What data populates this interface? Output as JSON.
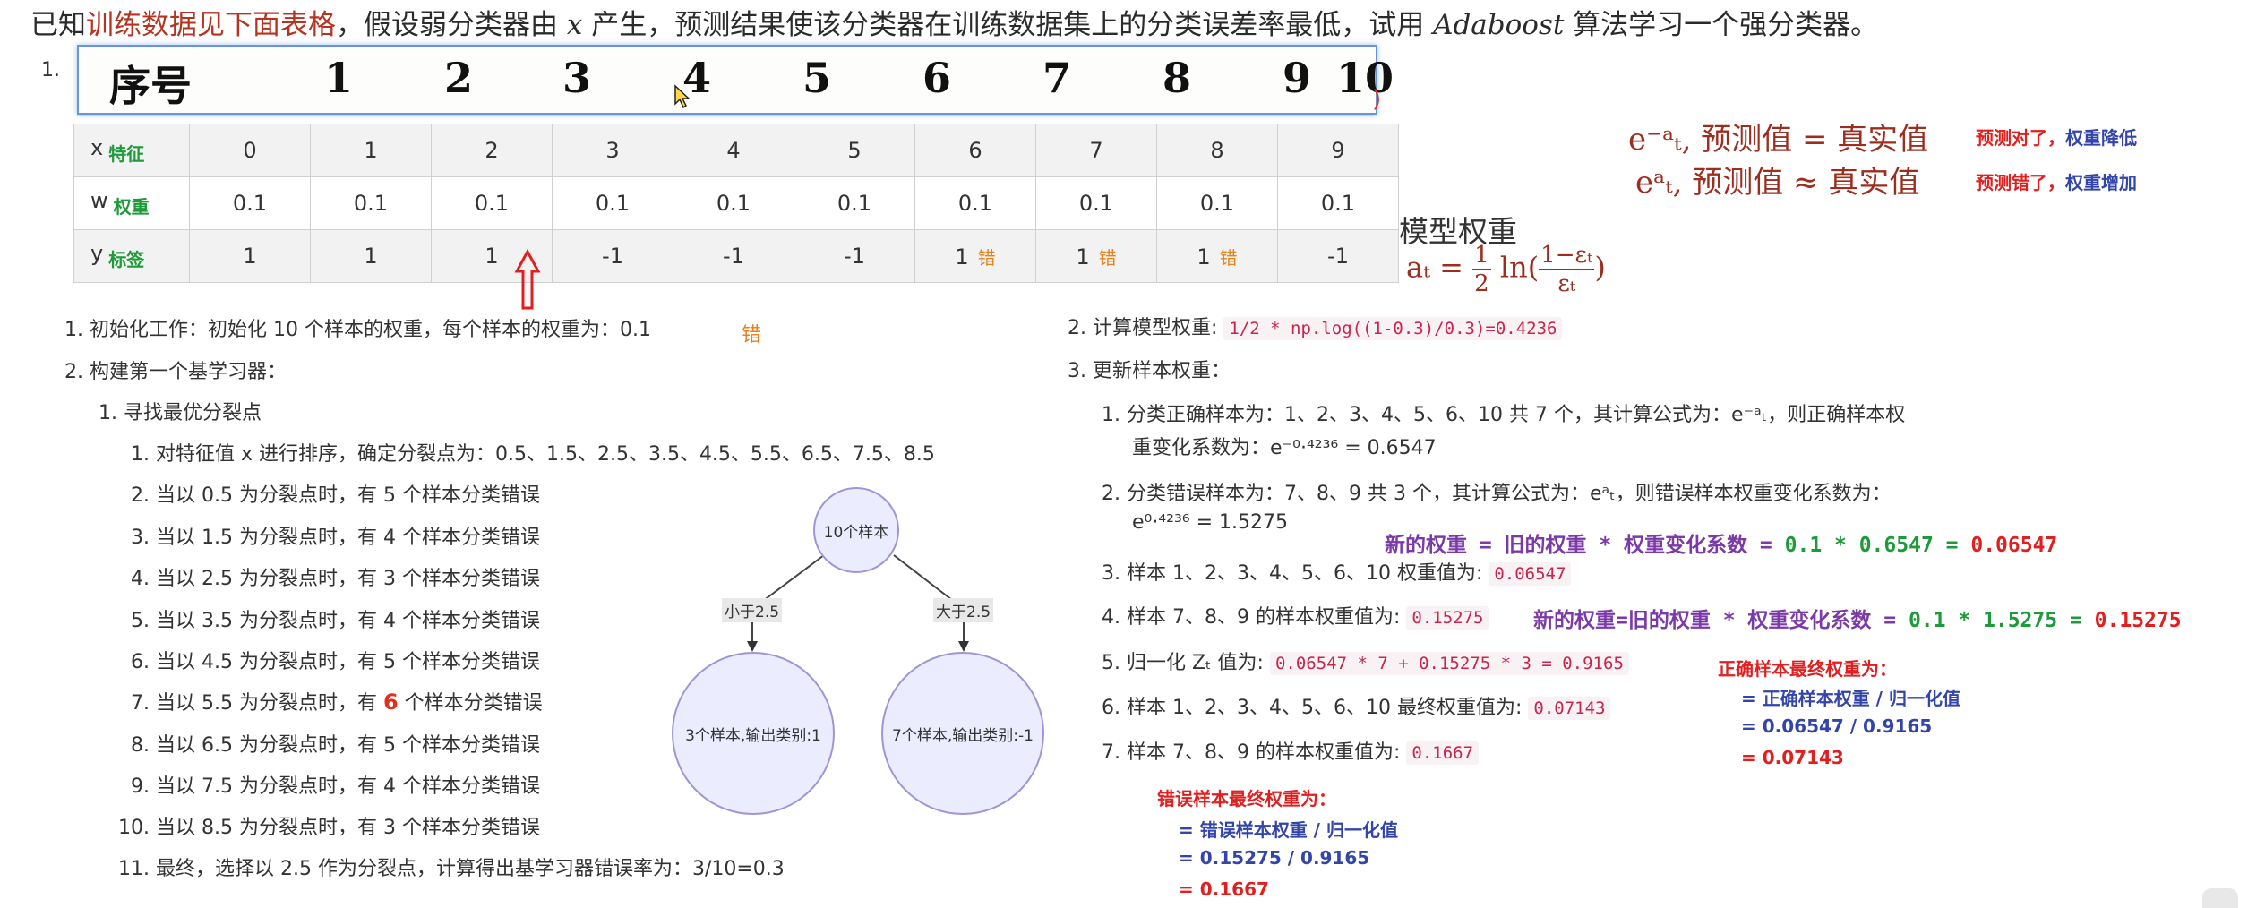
{
  "intro": {
    "prefix": "已知",
    "highlight": "训练数据见下面表格",
    "middle1": "，假设弱分类器由 ",
    "var_x": "x",
    "middle2": " 产生，预测结果使该分类器在训练数据集上的分类误差率最低，试用 ",
    "algo": "Adaboost",
    "suffix": " 算法学习一个强分类器。"
  },
  "list_marker_1": "1.",
  "scan_header": {
    "label": "序号",
    "numbers": [
      "1",
      "2",
      "3",
      "4",
      "5",
      "6",
      "7",
      "8",
      "9",
      "10"
    ]
  },
  "table": {
    "rows": [
      {
        "key": "x",
        "sub": "特征",
        "cells": [
          {
            "v": "0"
          },
          {
            "v": "1"
          },
          {
            "v": "2"
          },
          {
            "v": "3"
          },
          {
            "v": "4"
          },
          {
            "v": "5"
          },
          {
            "v": "6"
          },
          {
            "v": "7"
          },
          {
            "v": "8"
          },
          {
            "v": "9"
          }
        ]
      },
      {
        "key": "w",
        "sub": "权重",
        "cells": [
          {
            "v": "0.1"
          },
          {
            "v": "0.1"
          },
          {
            "v": "0.1"
          },
          {
            "v": "0.1"
          },
          {
            "v": "0.1"
          },
          {
            "v": "0.1"
          },
          {
            "v": "0.1"
          },
          {
            "v": "0.1"
          },
          {
            "v": "0.1"
          },
          {
            "v": "0.1"
          }
        ]
      },
      {
        "key": "y",
        "sub": "标签",
        "cells": [
          {
            "v": "1"
          },
          {
            "v": "1"
          },
          {
            "v": "1"
          },
          {
            "v": "-1"
          },
          {
            "v": "-1"
          },
          {
            "v": "-1"
          },
          {
            "v": "1",
            "e": "错"
          },
          {
            "v": "1",
            "e": "错"
          },
          {
            "v": "1",
            "e": "错"
          },
          {
            "v": "-1"
          }
        ]
      }
    ]
  },
  "left": {
    "s1": "1.  初始化工作：初始化 10 个样本的权重，每个样本的权重为：0.1",
    "s1_mark": "错",
    "s2": "2.  构建第一个基学习器：",
    "s21": "1.  寻找最优分裂点",
    "items": [
      "1.  对特征值 x 进行排序，确定分裂点为：0.5、1.5、2.5、3.5、4.5、5.5、6.5、7.5、8.5",
      "2.  当以 0.5 为分裂点时，有 5 个样本分类错误",
      "3.  当以 1.5 为分裂点时，有 4 个样本分类错误",
      "4.  当以 2.5 为分裂点时，有 3 个样本分类错误",
      "5.  当以 3.5 为分裂点时，有 4 个样本分类错误",
      "6.  当以 4.5 为分裂点时，有 5 个样本分类错误"
    ],
    "item7_a": "7.  当以 5.5 为分裂点时，有",
    "item7_b": "6",
    "item7_c": "个样本分类错误",
    "items2": [
      "8.  当以 6.5 为分裂点时，有 5 个样本分类错误",
      "9.  当以 7.5 为分裂点时，有 4 个样本分类错误",
      "10.  当以 8.5 为分裂点时，有 3 个样本分类错误",
      "11.  最终，选择以 2.5 作为分裂点，计算得出基学习器错误率为：3/10=0.3"
    ]
  },
  "tree": {
    "root": "10个样本",
    "left_edge": "小于2.5",
    "right_edge": "大于2.5",
    "left_leaf": "3个样本,输出类别:1",
    "right_leaf": "7个样本,输出类别:-1"
  },
  "formulas": {
    "f1_main": "e⁻ᵃₜ, 预测值 = 真实值",
    "f1_note_a": "预测对了，",
    "f1_note_b": "权重降低",
    "f2_main": "eᵃₜ, 预测值 ≈ 真实值",
    "f2_note_a": "预测错了，",
    "f2_note_b": "权重增加",
    "model_weight": "模型权重",
    "at_lhs": "aₜ =",
    "half_n": "1",
    "half_d": "2",
    "ln": "ln",
    "lp": "(",
    "rp": ")",
    "ratio_n": "1−εₜ",
    "ratio_d": "εₜ"
  },
  "right": {
    "r2_label": "2.  计算模型权重:",
    "r2_code": "1/2 * np.log((1-0.3)/0.3)=0.4236",
    "r3_label": "3.  更新样本权重：",
    "r31_a": "1.  分类正确样本为：1、2、3、4、5、6、10 共 7 个，其计算公式为：e⁻ᵃₜ，则正确样本权",
    "r31_b": "重变化系数为：e⁻⁰·⁴²³⁶ = 0.6547",
    "r32_a": "2.  分类错误样本为：7、8、9 共 3 个，其计算公式为：eᵃₜ，则错误样本权重变化系数为：",
    "r32_b": "e⁰·⁴²³⁶ = 1.5275",
    "note_new1": "新的权重 = 旧的权重 * 权重变化系数 = ",
    "note_new1_calc": "0.1 * 0.6547 = ",
    "note_new1_res": "0.06547",
    "r33_label": "3.  样本 1、2、3、4、5、6、10  权重值为:",
    "r33_code": "0.06547",
    "r34_label": "4.  样本 7、8、9  的样本权重值为:",
    "r34_code": "0.15275",
    "note_new2": "新的权重=旧的权重 * 权重变化系数 = ",
    "note_new2_calc": "0.1 * 1.5275 = ",
    "note_new2_res": "0.15275",
    "r35_label": "5.  归一化 Zₜ 值为:",
    "r35_code": "0.06547 * 7 + 0.15275 * 3 = 0.9165",
    "r36_label": "6.  样本 1、2、3、4、5、6、10  最终权重值为:",
    "r36_code": "0.07143",
    "r37_label": "7.  样本 7、8、9  的样本权重值为:",
    "r37_code": "0.1667",
    "correct_title": "正确样本最终权重为：",
    "correct_l1": "= 正确样本权重 / 归一化值",
    "correct_l2": "= 0.06547 / 0.9165",
    "correct_l3": "= 0.07143",
    "wrong_title": "错误样本最终权重为：",
    "wrong_l1": "= 错误样本权重 / 归一化值",
    "wrong_l2": "= 0.15275 / 0.9165",
    "wrong_l3": "= 0.1667"
  },
  "stray_red": ")"
}
